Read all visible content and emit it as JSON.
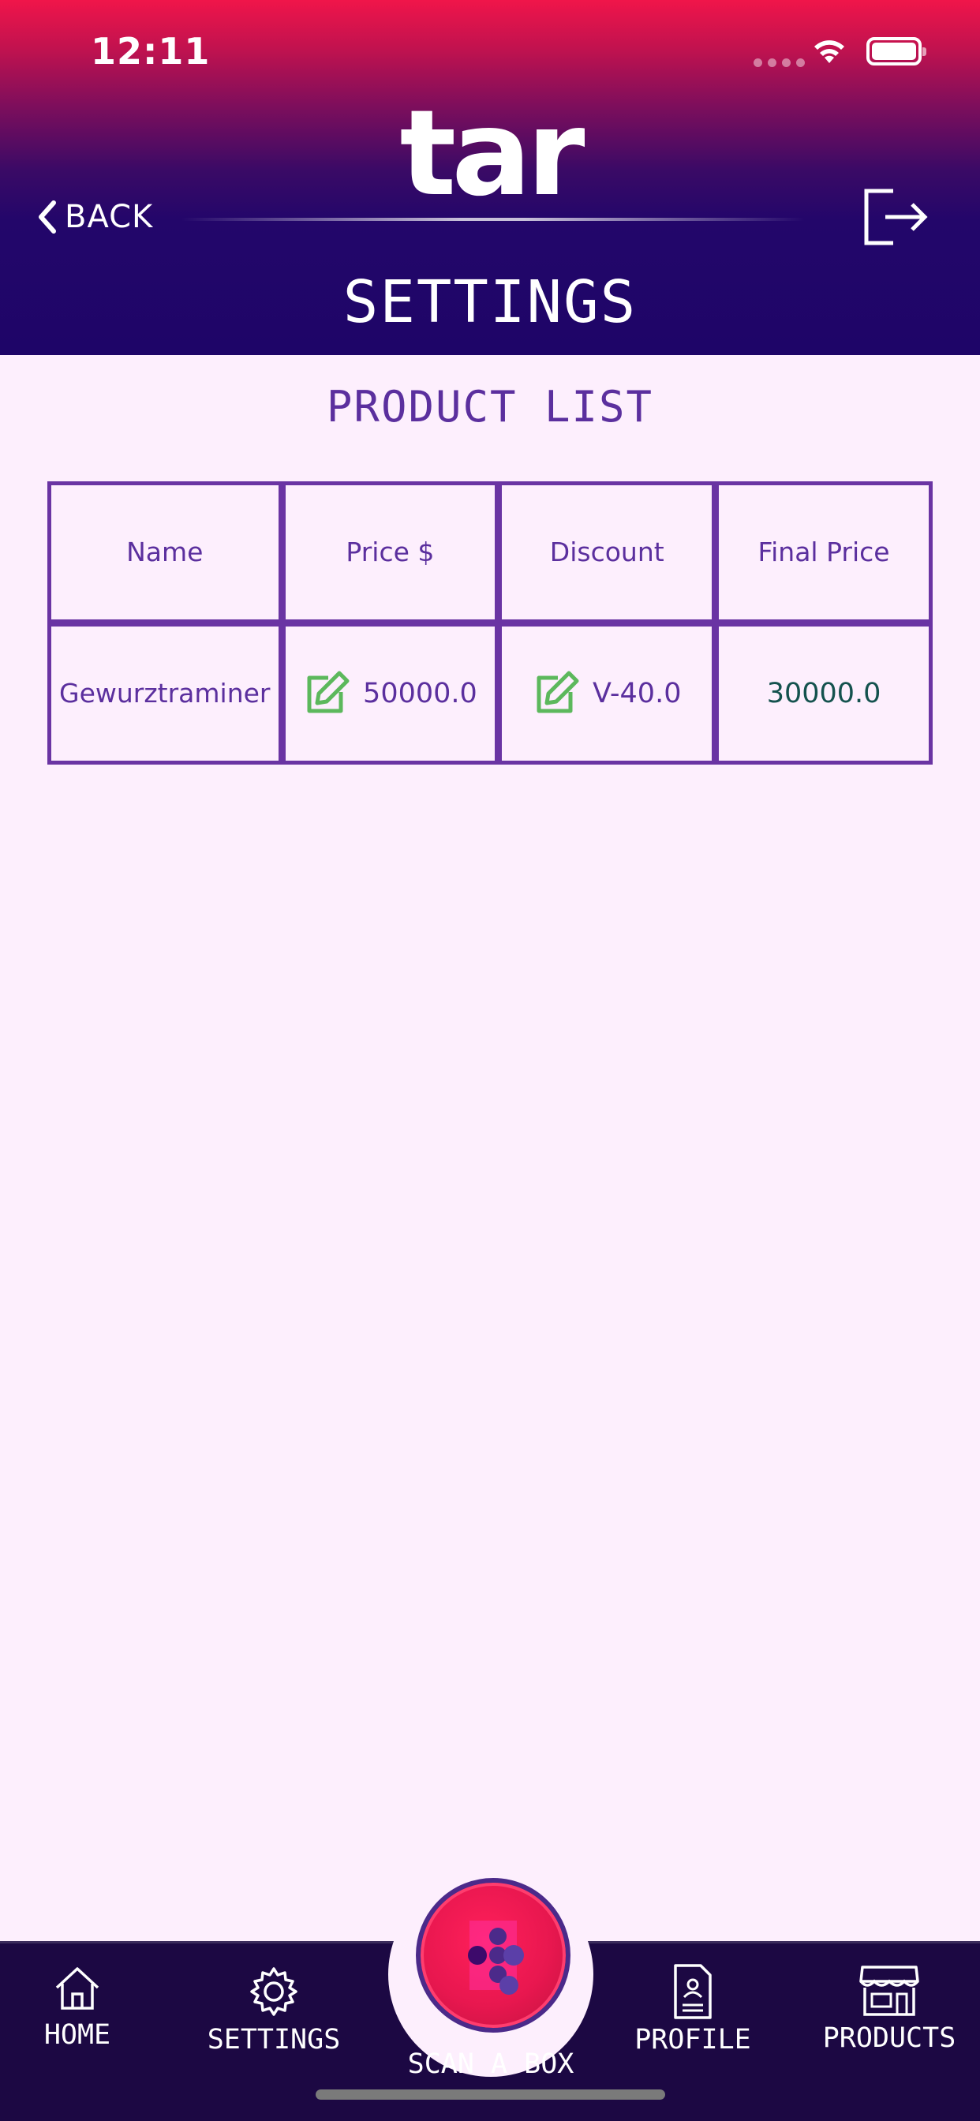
{
  "status_bar": {
    "time": "12:11"
  },
  "header": {
    "logo_text": "tar",
    "back_label": "BACK",
    "page_title": "SETTINGS"
  },
  "section": {
    "title": "PRODUCT LIST"
  },
  "table": {
    "headers": [
      "Name",
      "Price $",
      "Discount",
      "Final Price"
    ],
    "rows": [
      {
        "name": "Gewurztraminer",
        "price": "50000.0",
        "discount": "V-40.0",
        "final_price": "30000.0"
      }
    ]
  },
  "nav": {
    "home": "HOME",
    "settings": "SETTINGS",
    "scan": "SCAN A BOX",
    "profile": "PROFILE",
    "products": "PRODUCTS"
  },
  "colors": {
    "accent": "#5b2f9e",
    "edit_icon": "#5cb85c",
    "final_price": "#14524e",
    "nav_bg": "#1c0843",
    "scan_button": "#e8174f"
  }
}
